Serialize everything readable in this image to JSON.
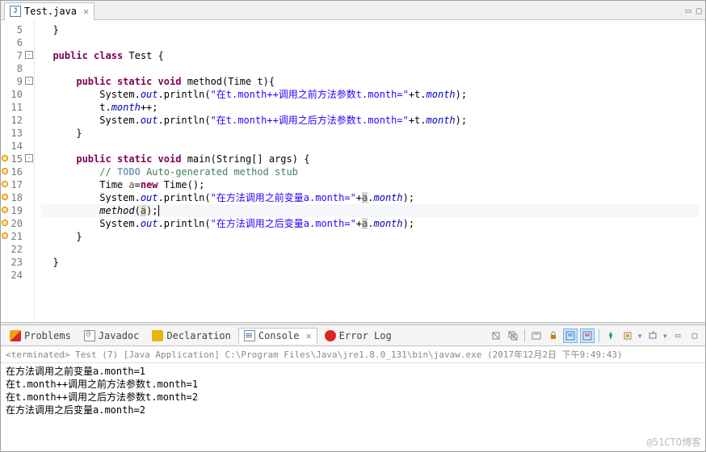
{
  "editor_tab": {
    "filename": "Test.java",
    "close_glyph": "✕"
  },
  "win_controls": {
    "min": "▭",
    "max": "▢"
  },
  "gutter": {
    "lines": [
      5,
      6,
      7,
      8,
      9,
      10,
      11,
      12,
      13,
      14,
      15,
      16,
      17,
      18,
      19,
      20,
      21,
      22,
      23,
      24
    ],
    "folds": [
      7,
      9,
      15
    ],
    "warn_markers": [
      15,
      16,
      17,
      18,
      19,
      20,
      21
    ]
  },
  "code": {
    "l5": "  }",
    "l7": {
      "pre": "  ",
      "kw1": "public",
      "sp1": " ",
      "kw2": "class",
      "sp2": " ",
      "name": "Test",
      "rest": " {"
    },
    "l9": {
      "pre": "      ",
      "kw1": "public",
      "sp1": " ",
      "kw2": "static",
      "sp2": " ",
      "kw3": "void",
      "sp3": " ",
      "fn": "method",
      "rest": "(Time t){"
    },
    "l10": {
      "pre": "          System.",
      "out": "out",
      ".p": ".println(",
      "str": "\"在t.month++调用之前方法参数t.month=\"",
      "mid": "+t.",
      "fld": "month",
      "end": ");"
    },
    "l11": {
      "pre": "          t.",
      "fld": "month",
      "end": "++;"
    },
    "l12": {
      "pre": "          System.",
      "out": "out",
      ".p": ".println(",
      "str": "\"在t.month++调用之后方法参数t.month=\"",
      "mid": "+t.",
      "fld": "month",
      "end": ");"
    },
    "l13": "      }",
    "l15": {
      "pre": "      ",
      "kw1": "public",
      "sp1": " ",
      "kw2": "static",
      "sp2": " ",
      "kw3": "void",
      "sp3": " ",
      "fn": "main",
      "rest": "(String[] args) {"
    },
    "l16": {
      "pre": "          ",
      "c1": "// ",
      "todo": "TODO",
      "c2": " Auto-generated method stub"
    },
    "l17": {
      "pre": "          Time ",
      "var": "a",
      "eq": "=",
      "kw": "new",
      "rest": " Time();"
    },
    "l18": {
      "pre": "          System.",
      "out": "out",
      ".p": ".println(",
      "str": "\"在方法调用之前变量a.month=\"",
      "mid": "+",
      "var": "a",
      "dot": ".",
      "fld": "month",
      "end": ");"
    },
    "l19": {
      "pre": "          ",
      "fn": "method",
      "op": "(",
      "var": "a",
      "end": ");"
    },
    "l20": {
      "pre": "          System.",
      "out": "out",
      ".p": ".println(",
      "str": "\"在方法调用之后变量a.month=\"",
      "mid": "+",
      "var": "a",
      "dot": ".",
      "fld": "month",
      "end": ");"
    },
    "l21": "      }",
    "l23": "  }"
  },
  "bottom": {
    "tabs": {
      "problems": "Problems",
      "javadoc": "Javadoc",
      "declaration": "Declaration",
      "console": "Console",
      "errorlog": "Error Log"
    },
    "close_glyph": "✕"
  },
  "console": {
    "status": "<terminated> Test (7) [Java Application] C:\\Program Files\\Java\\jre1.8.0_131\\bin\\javaw.exe (2017年12月2日 下午9:49:43)",
    "output": [
      "在方法调用之前变量a.month=1",
      "在t.month++调用之前方法参数t.month=1",
      "在t.month++调用之后方法参数t.month=2",
      "在方法调用之后变量a.month=2"
    ]
  },
  "watermark": "@51CTO博客"
}
